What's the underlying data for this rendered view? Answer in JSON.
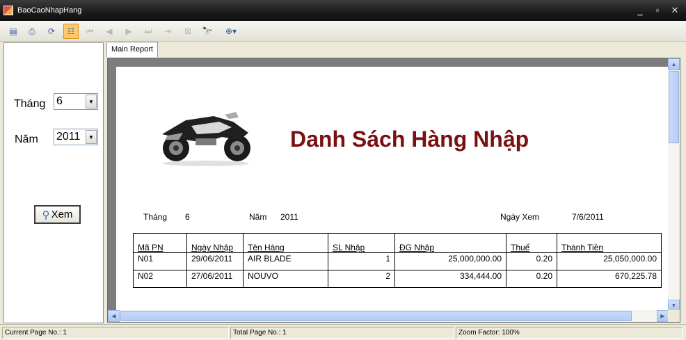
{
  "window": {
    "title": "BaoCaoNhapHang"
  },
  "toolbar": {
    "icons": [
      "export-icon",
      "print-icon",
      "refresh-icon",
      "group-tree-icon",
      "first-page-icon",
      "prev-page-icon",
      "next-page-icon",
      "last-page-icon",
      "goto-page-icon",
      "stop-icon",
      "find-icon",
      "zoom-icon"
    ]
  },
  "filters": {
    "month_label": "Tháng",
    "month_value": "6",
    "year_label": "Năm",
    "year_value": "2011",
    "view_button": "Xem"
  },
  "tab": {
    "label": "Main Report"
  },
  "report": {
    "title": "Danh Sách Hàng Nhập",
    "month_label": "Tháng",
    "month_value": "6",
    "year_label": "Năm",
    "year_value": "2011",
    "view_date_label": "Ngày Xem",
    "view_date_value": "7/6/2011",
    "columns": [
      "Mã PN",
      "Ngày Nhập",
      "Tên Hàng",
      "SL Nhập",
      "ĐG Nhập",
      "Thuế",
      "Thành Tiền"
    ],
    "rows": [
      [
        "N01",
        "29/06/2011",
        "AIR BLADE",
        "1",
        "25,000,000.00",
        "0.20",
        "25,050,000.00"
      ],
      [
        "N02",
        "27/06/2011",
        "NOUVO",
        "2",
        "334,444.00",
        "0.20",
        "670,225.78"
      ]
    ]
  },
  "status": {
    "current_page": "Current Page No.: 1",
    "total_page": "Total Page No.: 1",
    "zoom": "Zoom Factor: 100%"
  },
  "colors": {
    "title_red": "#7a1010",
    "titlebar": "#1a1a1a",
    "accent_orange": "#ffc96b"
  }
}
